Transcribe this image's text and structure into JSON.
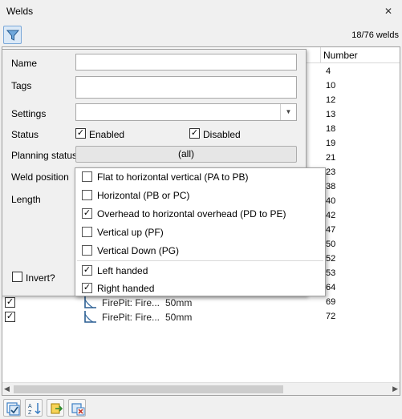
{
  "window": {
    "title": "Welds",
    "close_glyph": "✕"
  },
  "toolbar": {
    "filter_icon": "filter-icon",
    "weld_count": "18/76 welds"
  },
  "table": {
    "number_header": "Number",
    "numbers": [
      "4",
      "10",
      "12",
      "13",
      "18",
      "19",
      "21",
      "23",
      "38",
      "40",
      "42",
      "47",
      "50",
      "52",
      "53",
      "64",
      "69",
      "72"
    ],
    "visible_rows": [
      {
        "checked": true,
        "name": "FirePit: Fire...",
        "length": "50mm"
      },
      {
        "checked": true,
        "name": "FirePit: Fire...",
        "length": "50mm"
      }
    ]
  },
  "filter_panel": {
    "name_label": "Name",
    "name_value": "",
    "tags_label": "Tags",
    "tags_value": "",
    "settings_label": "Settings",
    "settings_value": "",
    "status_label": "Status",
    "enabled_label": "Enabled",
    "enabled_checked": true,
    "disabled_label": "Disabled",
    "disabled_checked": true,
    "planning_label": "Planning status",
    "planning_value": "(all)",
    "weld_position_label": "Weld position",
    "length_label": "Length",
    "invert_label": "Invert?",
    "invert_checked": false
  },
  "weld_position_menu": {
    "items": [
      {
        "label": "Flat to horizontal vertical (PA to PB)",
        "checked": false
      },
      {
        "label": "Horizontal (PB or PC)",
        "checked": false
      },
      {
        "label": "Overhead to horizontal overhead (PD to PE)",
        "checked": true
      },
      {
        "label": "Vertical up (PF)",
        "checked": false
      },
      {
        "label": "Vertical Down (PG)",
        "checked": false
      }
    ],
    "hand_items": [
      {
        "label": "Left handed",
        "checked": true
      },
      {
        "label": "Right handed",
        "checked": true
      }
    ]
  },
  "bottom_toolbar": {
    "buttons": [
      "select-all-icon",
      "sort-az-icon",
      "export-icon",
      "remove-icon"
    ]
  },
  "colors": {
    "accent": "#3c7fc4",
    "selection": "#dbe9f7"
  }
}
